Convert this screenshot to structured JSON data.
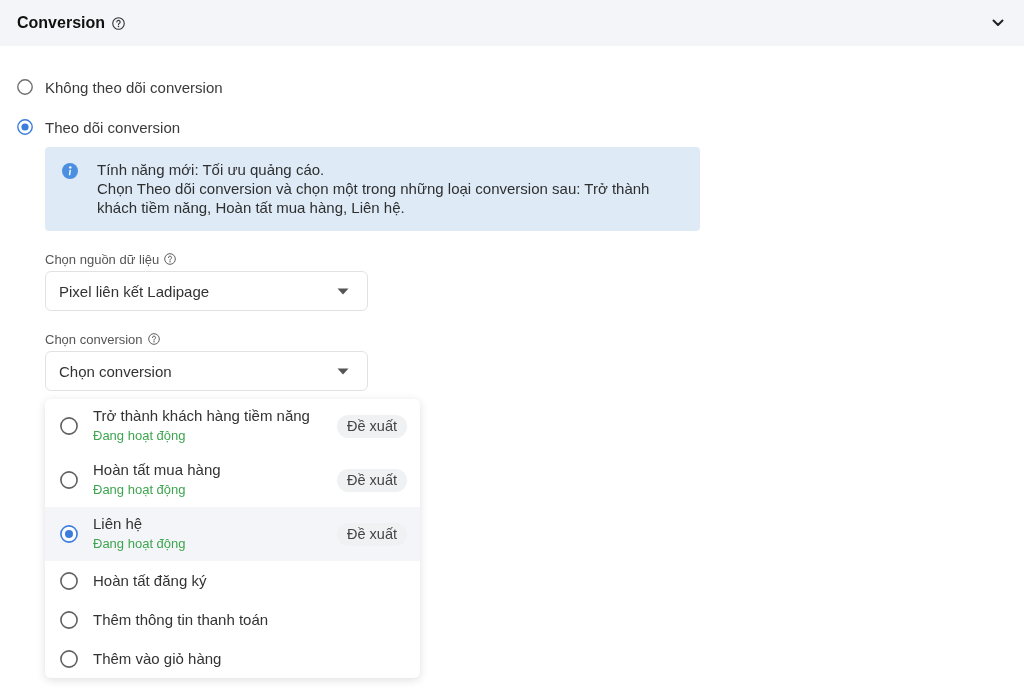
{
  "section": {
    "title": "Conversion"
  },
  "tracking_options": [
    {
      "label": "Không theo dõi conversion",
      "selected": false
    },
    {
      "label": "Theo dõi conversion",
      "selected": true
    }
  ],
  "info_banner": {
    "title": "Tính năng mới: Tối ưu quảng cáo.",
    "text": "Chọn Theo dõi conversion và chọn một trong những loại conversion sau: Trở thành khách tiềm năng, Hoàn tất mua hàng, Liên hệ."
  },
  "data_source": {
    "label": "Chọn nguồn dữ liệu",
    "value": "Pixel liên kết Ladipage"
  },
  "conversion": {
    "label": "Chọn conversion",
    "placeholder": "Chọn conversion",
    "options": [
      {
        "name": "Trở thành khách hàng tiềm năng",
        "status": "Đang hoạt động",
        "badge": "Đề xuất",
        "selected": false
      },
      {
        "name": "Hoàn tất mua hàng",
        "status": "Đang hoạt động",
        "badge": "Đề xuất",
        "selected": false
      },
      {
        "name": "Liên hệ",
        "status": "Đang hoạt động",
        "badge": "Đề xuất",
        "selected": true
      },
      {
        "name": "Hoàn tất đăng ký",
        "selected": false
      },
      {
        "name": "Thêm thông tin thanh toán",
        "selected": false
      },
      {
        "name": "Thêm vào giỏ hàng",
        "selected": false
      }
    ]
  }
}
